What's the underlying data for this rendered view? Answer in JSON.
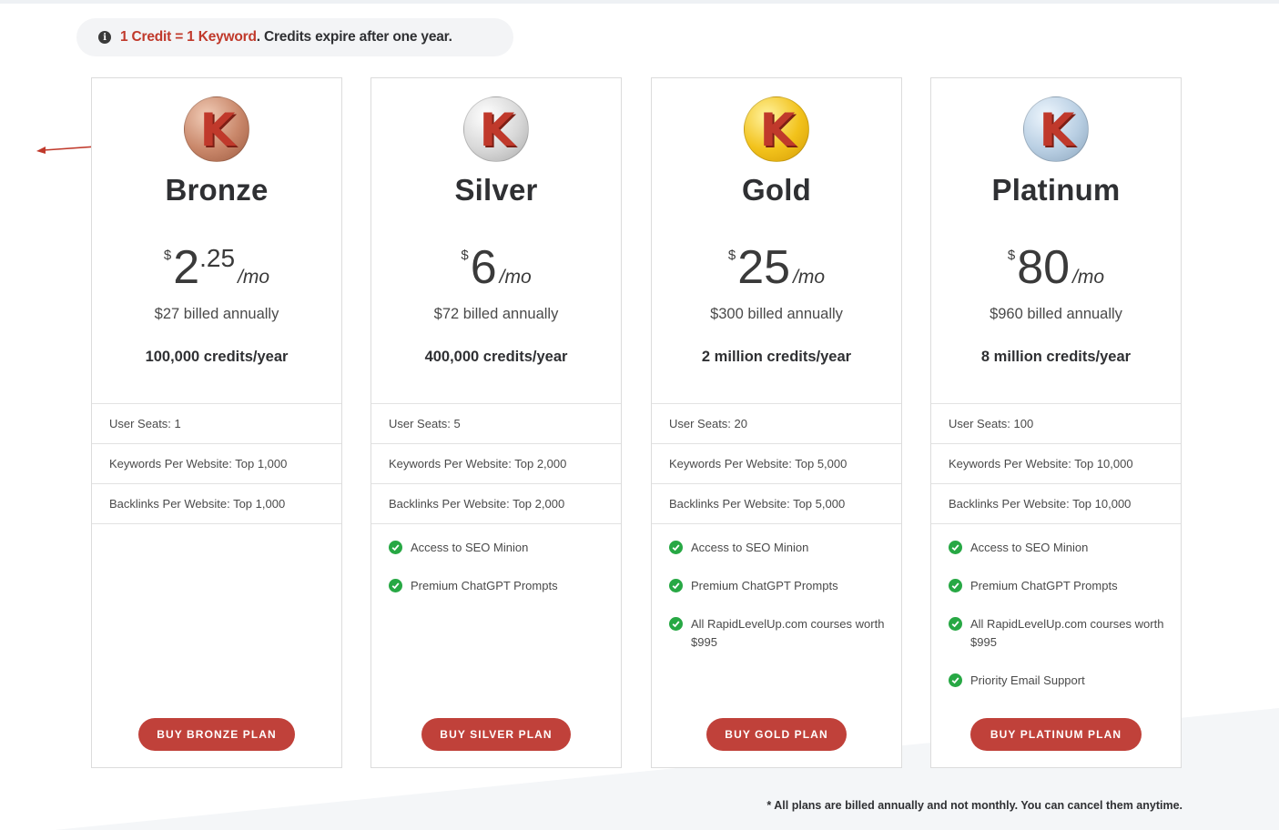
{
  "notice": {
    "highlight": "1 Credit = 1 Keyword",
    "rest": ". Credits expire after one year."
  },
  "colors": {
    "accent": "#c0413a",
    "check": "#27a844",
    "bronze": "#c9876a",
    "silver": "#d8d8d8",
    "gold": "#f2c21b",
    "platinum": "#b9cfe3"
  },
  "plans": [
    {
      "name": "Bronze",
      "currency": "$",
      "amount": "2",
      "decimal": ".25",
      "per": "/mo",
      "billed": "$27 billed annually",
      "credits": "100,000 credits/year",
      "seats": "User Seats: 1",
      "keywords": "Keywords Per Website: Top 1,000",
      "backlinks": "Backlinks Per Website: Top 1,000",
      "features": [],
      "button": "BUY BRONZE PLAN"
    },
    {
      "name": "Silver",
      "currency": "$",
      "amount": "6",
      "decimal": "",
      "per": "/mo",
      "billed": "$72 billed annually",
      "credits": "400,000 credits/year",
      "seats": "User Seats: 5",
      "keywords": "Keywords Per Website: Top 2,000",
      "backlinks": "Backlinks Per Website: Top 2,000",
      "features": [
        "Access to SEO Minion",
        "Premium ChatGPT Prompts"
      ],
      "button": "BUY SILVER PLAN"
    },
    {
      "name": "Gold",
      "currency": "$",
      "amount": "25",
      "decimal": "",
      "per": "/mo",
      "billed": "$300 billed annually",
      "credits": "2 million credits/year",
      "seats": "User Seats: 20",
      "keywords": "Keywords Per Website: Top 5,000",
      "backlinks": "Backlinks Per Website: Top 5,000",
      "features": [
        "Access to SEO Minion",
        "Premium ChatGPT Prompts",
        "All RapidLevelUp.com courses worth $995"
      ],
      "button": "BUY GOLD PLAN"
    },
    {
      "name": "Platinum",
      "currency": "$",
      "amount": "80",
      "decimal": "",
      "per": "/mo",
      "billed": "$960 billed annually",
      "credits": "8 million credits/year",
      "seats": "User Seats: 100",
      "keywords": "Keywords Per Website: Top 10,000",
      "backlinks": "Backlinks Per Website: Top 10,000",
      "features": [
        "Access to SEO Minion",
        "Premium ChatGPT Prompts",
        "All RapidLevelUp.com courses worth $995",
        "Priority Email Support"
      ],
      "button": "BUY PLATINUM PLAN"
    }
  ],
  "icons": {
    "info": "info-icon",
    "coin": "k-coin-icon",
    "check": "check-circle-icon",
    "arrow": "red-arrow-icon"
  },
  "coin_letter": "K",
  "info_glyph": "i",
  "footnote": "* All plans are billed annually and not monthly. You can cancel them anytime."
}
